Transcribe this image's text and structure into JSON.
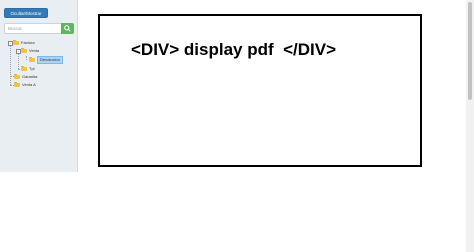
{
  "sidebar": {
    "toggle_label": "Ocultar/Mostrar",
    "search": {
      "placeholder": "Buscar",
      "value": ""
    },
    "tree": [
      {
        "label": "Factura"
      },
      {
        "label": "Venta"
      },
      {
        "label": "Devolucion"
      },
      {
        "label": "Tpl"
      },
      {
        "label": "Garantia"
      },
      {
        "label": "Venta A"
      }
    ]
  },
  "content": {
    "text": "<DIV> display pdf  </DIV>"
  },
  "colors": {
    "accent_blue": "#337ab7",
    "search_green": "#5cb85c",
    "folder": "#f0c24b",
    "selected": "#a9d4f5"
  }
}
